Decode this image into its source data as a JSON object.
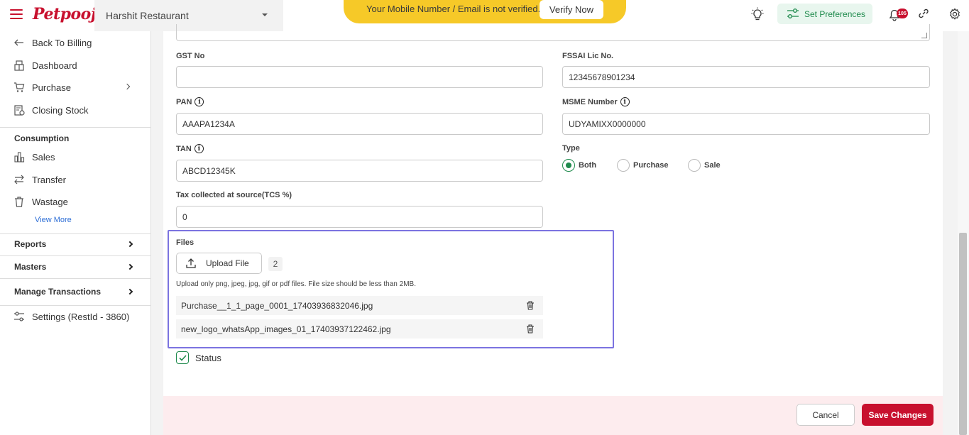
{
  "app": {
    "logo_text": "Petpooja",
    "brand_color": "#c8102e",
    "accent_green": "#1e8a4c",
    "files_highlight": "#7b73e0"
  },
  "header": {
    "restaurant": "Harshit Restaurant",
    "verify_message": "Your Mobile Number / Email is not verified.",
    "verify_button": "Verify Now",
    "preferences_button": "Set Preferences",
    "notification_count": "105",
    "icons": [
      "menu-icon",
      "bulb-icon",
      "preferences-icon",
      "bell-icon",
      "link-icon",
      "gear-icon"
    ]
  },
  "sidebar": {
    "items": [
      {
        "label": "Back To Billing",
        "icon": "arrow-left-icon"
      },
      {
        "label": "Dashboard",
        "icon": "dashboard-icon"
      },
      {
        "label": "Purchase",
        "icon": "cart-icon"
      },
      {
        "label": "Closing Stock",
        "icon": "stock-icon"
      }
    ],
    "consumption_heading": "Consumption",
    "consumption_items": [
      {
        "label": "Sales",
        "icon": "chart-icon"
      },
      {
        "label": "Transfer",
        "icon": "transfer-icon"
      },
      {
        "label": "Wastage",
        "icon": "trash-icon"
      }
    ],
    "view_more": "View More",
    "sections": [
      {
        "label": "Reports"
      },
      {
        "label": "Masters"
      },
      {
        "label": "Manage Transactions"
      }
    ],
    "settings": "Settings (RestId - 3860)"
  },
  "form": {
    "gst_label": "GST No",
    "gst_value": "",
    "fssai_label": "FSSAI Lic No.",
    "fssai_value": "12345678901234",
    "pan_label": "PAN",
    "pan_value": "AAAPA1234A",
    "msme_label": "MSME Number",
    "msme_value": "UDYAMIXX0000000",
    "tan_label": "TAN",
    "tan_value": "ABCD12345K",
    "type_label": "Type",
    "type_options": [
      "Both",
      "Purchase",
      "Sale"
    ],
    "type_selected": "Both",
    "tcs_label": "Tax collected at source(TCS %)",
    "tcs_value": "0",
    "files_label": "Files",
    "upload_button": "Upload File",
    "file_count": "2",
    "upload_hint": "Upload only png, jpeg, jpg, gif or pdf files. File size should be less than 2MB.",
    "files": [
      "Purchase__1_1_page_0001_17403936832046.jpg",
      "new_logo_whatsApp_images_01_17403937122462.jpg"
    ],
    "status_label": "Status",
    "status_checked": true
  },
  "footer": {
    "cancel": "Cancel",
    "save": "Save Changes"
  }
}
